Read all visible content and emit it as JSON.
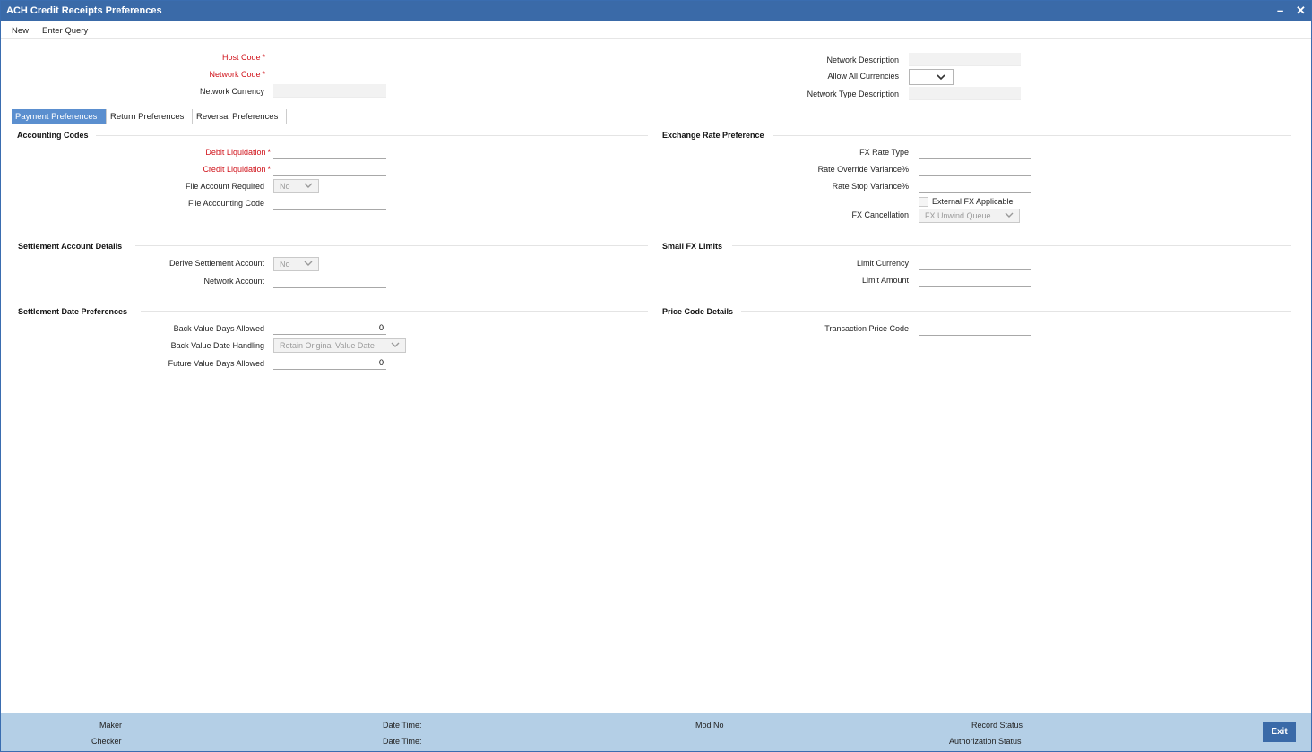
{
  "window": {
    "title": "ACH Credit Receipts Preferences",
    "minimize_icon": "–",
    "close_icon": "✕"
  },
  "menu": {
    "new": "New",
    "enter_query": "Enter Query"
  },
  "header": {
    "host_code_label": "Host Code",
    "network_code_label": "Network Code",
    "network_currency_label": "Network Currency",
    "network_description_label": "Network Description",
    "allow_all_currencies_label": "Allow All Currencies",
    "network_type_description_label": "Network Type Description"
  },
  "tabs": [
    "Payment Preferences",
    "Return Preferences",
    "Reversal Preferences"
  ],
  "accounting_codes": {
    "title": "Accounting Codes",
    "debit_liquidation_label": "Debit Liquidation",
    "credit_liquidation_label": "Credit Liquidation",
    "file_account_required_label": "File Account Required",
    "file_account_required_value": "No",
    "file_accounting_code_label": "File Accounting Code"
  },
  "exchange_rate": {
    "title": "Exchange Rate Preference",
    "fx_rate_type_label": "FX Rate Type",
    "rate_override_variance_label": "Rate Override Variance%",
    "rate_stop_variance_label": "Rate Stop Variance%",
    "external_fx_label": "External FX Applicable",
    "fx_cancellation_label": "FX Cancellation",
    "fx_cancellation_value": "FX Unwind Queue"
  },
  "settlement_account": {
    "title": "Settlement Account Details",
    "derive_settlement_label": "Derive Settlement Account",
    "derive_settlement_value": "No",
    "network_account_label": "Network Account"
  },
  "small_fx": {
    "title": "Small FX Limits",
    "limit_currency_label": "Limit Currency",
    "limit_amount_label": "Limit Amount"
  },
  "settlement_date": {
    "title": "Settlement Date Preferences",
    "back_value_days_label": "Back Value Days Allowed",
    "back_value_days_value": "0",
    "back_value_handling_label": "Back Value Date Handling",
    "back_value_handling_value": "Retain Original Value Date",
    "future_value_days_label": "Future Value Days Allowed",
    "future_value_days_value": "0"
  },
  "price_code": {
    "title": "Price Code Details",
    "transaction_price_code_label": "Transaction Price Code"
  },
  "footer": {
    "maker": "Maker",
    "checker": "Checker",
    "date_time_1": "Date Time:",
    "date_time_2": "Date Time:",
    "mod_no": "Mod No",
    "record_status": "Record Status",
    "authorization_status": "Authorization Status",
    "exit": "Exit"
  }
}
